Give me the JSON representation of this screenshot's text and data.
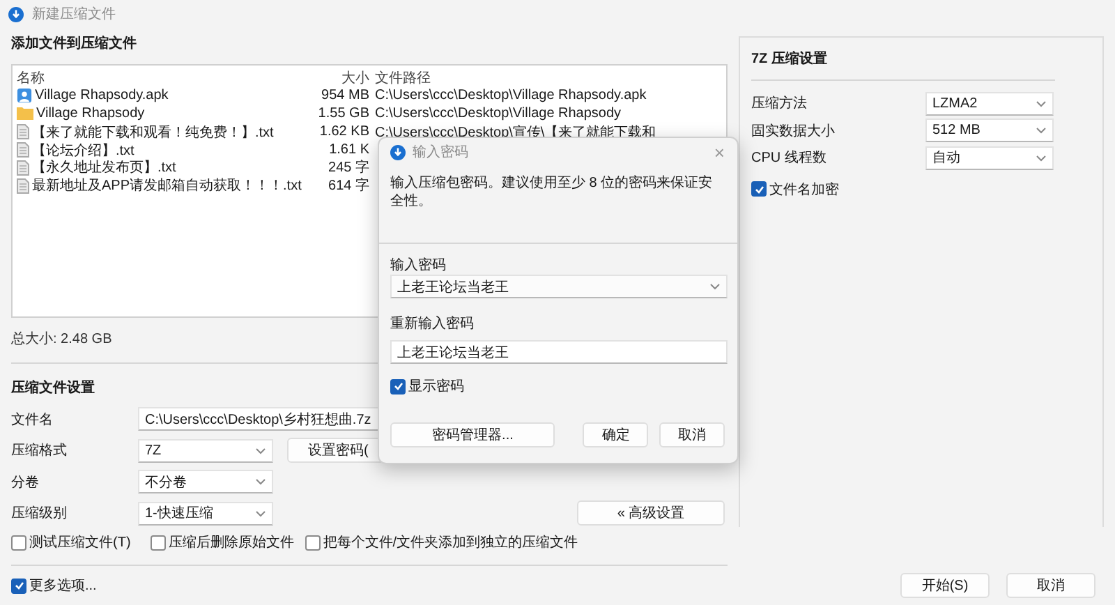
{
  "window": {
    "title": "新建压缩文件"
  },
  "files": {
    "title": "添加文件到压缩文件",
    "columns": [
      "名称",
      "大小",
      "文件路径"
    ],
    "rows": [
      {
        "kind": "apk",
        "name": "Village Rhapsody.apk",
        "size": "954 MB",
        "path": "C:\\Users\\ccc\\Desktop\\Village Rhapsody.apk"
      },
      {
        "kind": "folder",
        "name": "Village Rhapsody",
        "size": "1.55 GB",
        "path": "C:\\Users\\ccc\\Desktop\\Village Rhapsody"
      },
      {
        "kind": "text",
        "name": "【来了就能下载和观看！纯免费！】.txt",
        "size": "1.62 KB",
        "path": "C:\\Users\\ccc\\Desktop\\宣传\\【来了就能下载和"
      },
      {
        "kind": "text",
        "name": "【论坛介绍】.txt",
        "size": "1.61 K"
      },
      {
        "kind": "text",
        "name": "【永久地址发布页】.txt",
        "size": "245 字"
      },
      {
        "kind": "text",
        "name": "最新地址及APP请发邮箱自动获取！！！.txt",
        "size": "614 字"
      }
    ],
    "total": "总大小: 2.48 GB"
  },
  "settings": {
    "title": "压缩文件设置",
    "filename": {
      "label": "文件名",
      "value": "C:\\Users\\ccc\\Desktop\\乡村狂想曲.7z"
    },
    "format": {
      "label": "压缩格式",
      "value": "7Z"
    },
    "password_button": "设置密码(",
    "split": {
      "label": "分卷",
      "value": "不分卷"
    },
    "level": {
      "label": "压缩级别",
      "value": "1-快速压缩"
    },
    "advanced_button": "« 高级设置",
    "options": [
      {
        "label": "测试压缩文件(T)",
        "checked": false
      },
      {
        "label": "压缩后删除原始文件",
        "checked": false
      },
      {
        "label": "把每个文件/文件夹添加到独立的压缩文件",
        "checked": false
      }
    ]
  },
  "more_options": {
    "label": "更多选项...",
    "checked": true
  },
  "buttons": [
    "开始(S)",
    "取消"
  ],
  "sevenzip": {
    "title": "7Z 压缩设置",
    "fields": [
      {
        "label": "压缩方法",
        "value": "LZMA2"
      },
      {
        "label": "固实数据大小",
        "value": "512 MB"
      },
      {
        "label": "CPU 线程数",
        "value": "自动"
      }
    ],
    "encrypt_names": {
      "label": "文件名加密",
      "checked": true
    }
  },
  "dialog": {
    "title": "输入密码",
    "close": "×",
    "message": "输入压缩包密码。建议使用至少 8 位的密码来保证安全性。",
    "password_label": "输入密码",
    "password": "上老王论坛当老王",
    "confirm_label": "重新输入密码",
    "confirm": "上老王论坛当老王",
    "show_password": {
      "label": "显示密码",
      "checked": true
    },
    "buttons": [
      "密码管理器...",
      "确定",
      "取消"
    ]
  }
}
